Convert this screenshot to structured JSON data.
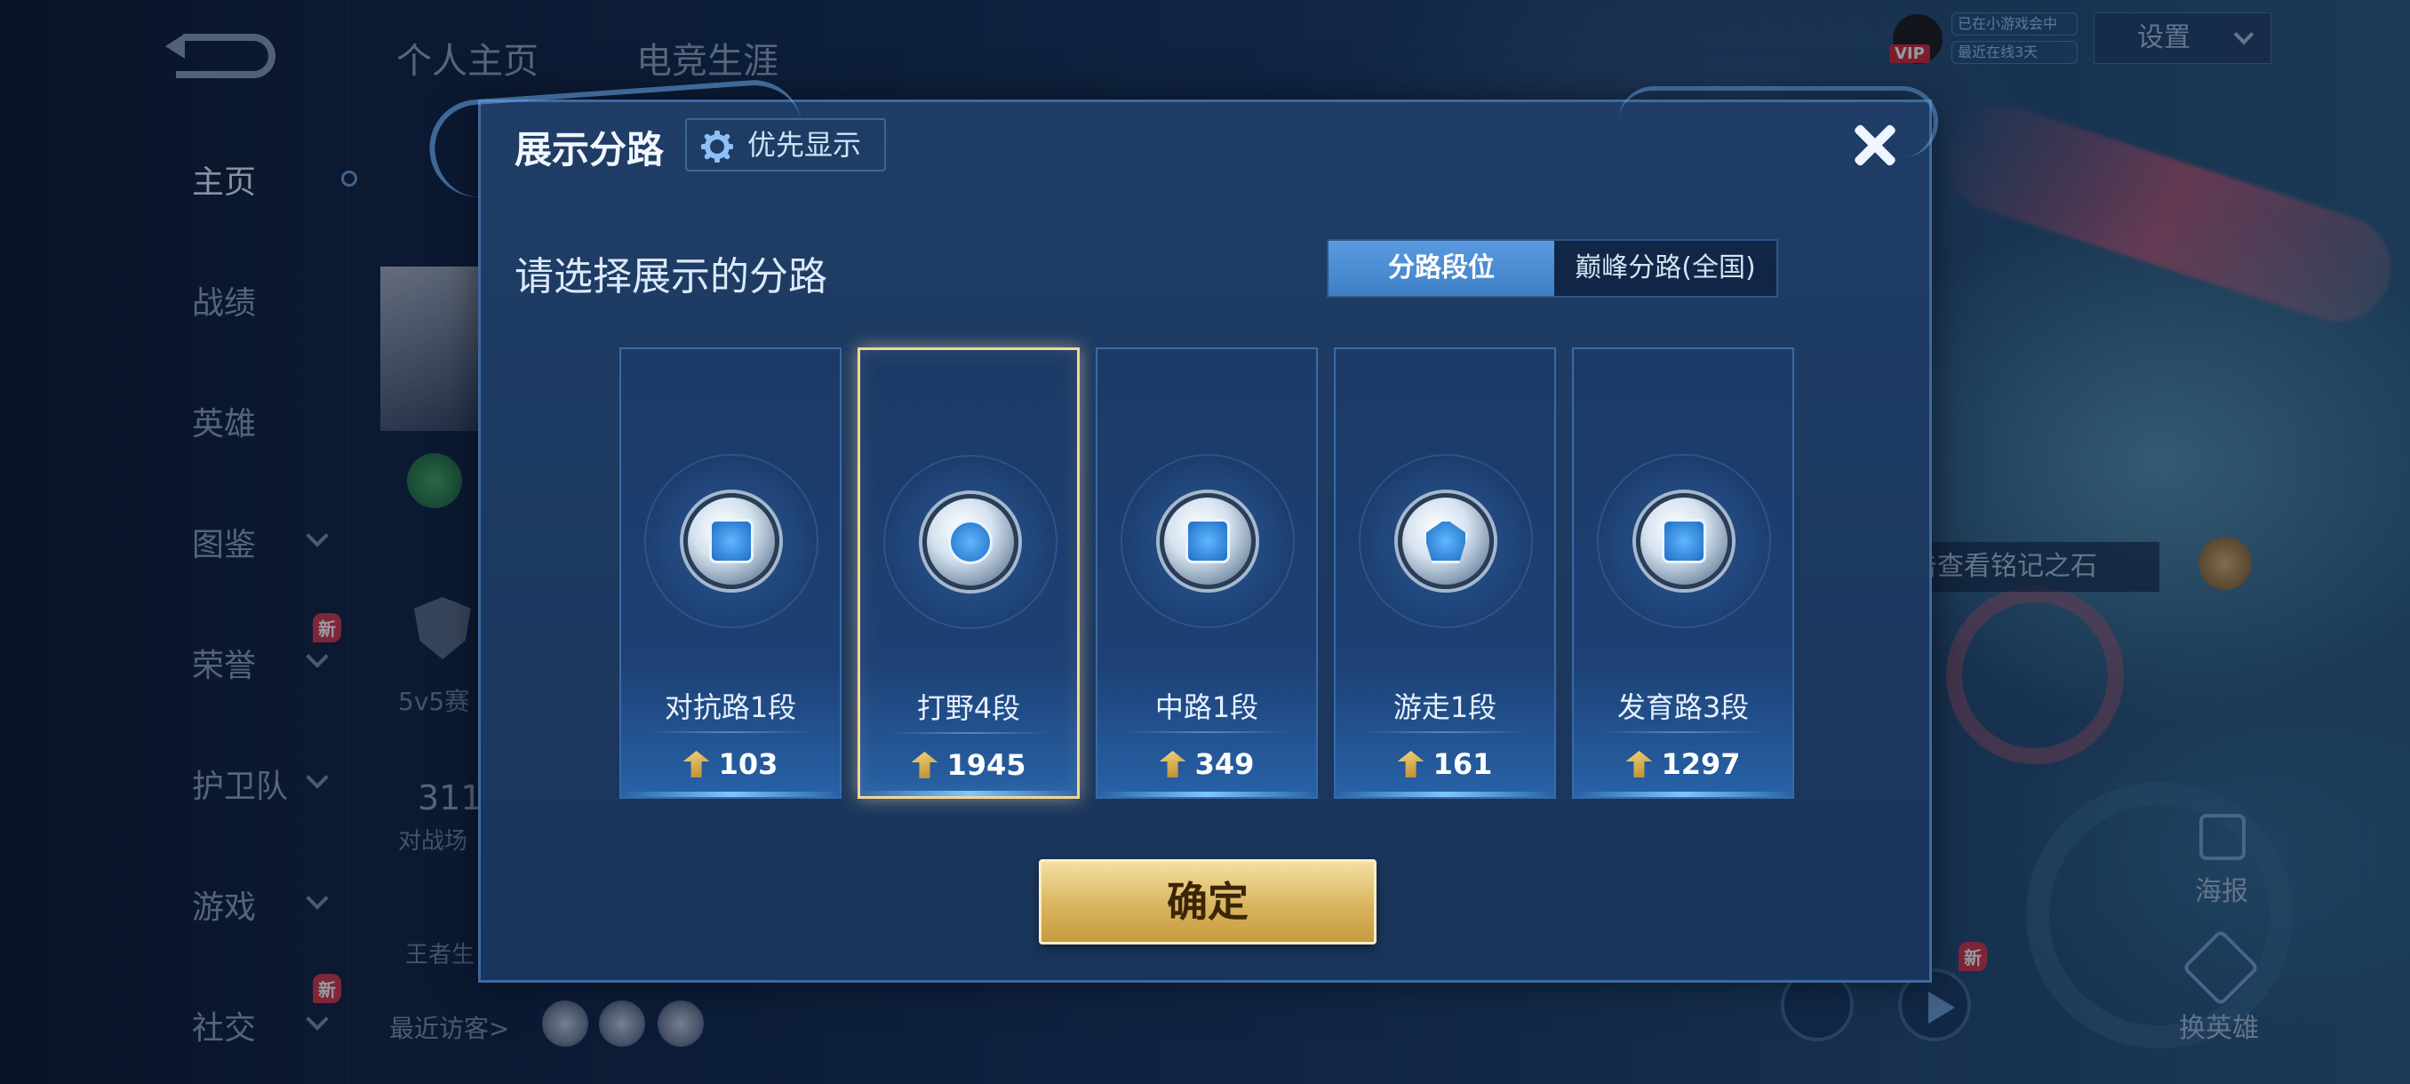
{
  "sidebar": {
    "items": [
      {
        "label": "主页",
        "active": true
      },
      {
        "label": "战绩"
      },
      {
        "label": "英雄"
      },
      {
        "label": "图鉴"
      },
      {
        "label": "荣誉",
        "badge": "新"
      },
      {
        "label": "护卫队"
      },
      {
        "label": "游戏"
      },
      {
        "label": "社交",
        "badge": "新"
      }
    ]
  },
  "top_tabs": [
    "个人主页",
    "电竞生涯"
  ],
  "background": {
    "mode_label": "5v5赛",
    "match_count": "311",
    "match_label": "对战场",
    "wz_label": "王者生",
    "visitors_label": "最近访客>",
    "settings_label": "设置",
    "status_line1": "已在小游戏会中",
    "status_line2": "最近在线3天",
    "vip_tag": "VIP",
    "rune_tip": "击查看铭记之石",
    "poster_label": "海报",
    "change_hero_label": "换英雄",
    "new_badge": "新"
  },
  "modal": {
    "title": "展示分路",
    "priority_button": "优先显示",
    "prompt": "请选择展示的分路",
    "tabs": [
      {
        "label": "分路段位",
        "active": true
      },
      {
        "label": "巅峰分路(全国)",
        "active": false
      }
    ],
    "lanes": [
      {
        "name": "对抗路1段",
        "score": "103",
        "icon": "clash-lane-icon",
        "selected": false
      },
      {
        "name": "打野4段",
        "score": "1945",
        "icon": "jungle-icon",
        "selected": true
      },
      {
        "name": "中路1段",
        "score": "349",
        "icon": "mid-lane-icon",
        "selected": false
      },
      {
        "name": "游走1段",
        "score": "161",
        "icon": "roam-icon",
        "selected": false
      },
      {
        "name": "发育路3段",
        "score": "1297",
        "icon": "farm-lane-icon",
        "selected": false
      }
    ],
    "confirm_button": "确定"
  },
  "colors": {
    "accent_gold": "#d9b45f",
    "tab_active_blue": "#4f8fd8",
    "modal_bg": "#1f3d66"
  }
}
